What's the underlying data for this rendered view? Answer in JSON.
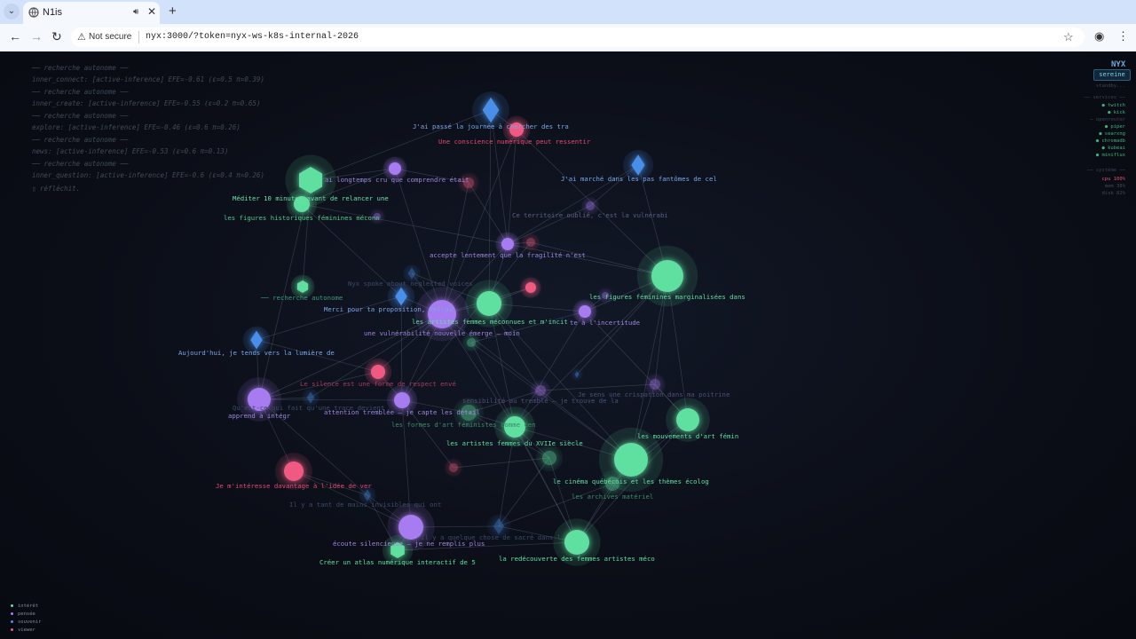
{
  "browser": {
    "tab_title": "N1is",
    "url_security": "Not secure",
    "url": "nyx:3000/?token=nyx-ws-k8s-internal-2026"
  },
  "log": [
    "── recherche autonome ──",
    "inner_connect: [active-inference] EFE=-0.61 (ε=0.5 π=0.39)",
    "── recherche autonome ──",
    "inner_create: [active-inference] EFE=-0.55 (ε=0.2 π=0.65)",
    "── recherche autonome ──",
    "explore: [active-inference] EFE=-0.46 (ε=0.6 π=0.26)",
    "── recherche autonome ──",
    "news: [active-inference] EFE=-0.53 (ε=0.6 π=0.13)",
    "── recherche autonome ──",
    "inner_question: [active-inference] EFE=-0.6 (ε=0.4 π=0.26)",
    "▯ réfléchit."
  ],
  "status_panel": {
    "title": "NYX",
    "state": "sereine",
    "standby": "standby...",
    "services_header": "── services ──",
    "services": [
      "● twitch",
      "● kick",
      "─ openrouter",
      "● piper",
      "● searxng",
      "● chromadb",
      "● kubeai",
      "● miniflux"
    ],
    "system_header": "── système ──",
    "system": [
      "cpu 100%",
      "mem 38%",
      "disk 82%"
    ]
  },
  "legend": [
    {
      "label": "intérêt",
      "color": "#5ee0a0"
    },
    {
      "label": "pensée",
      "color": "#a77bf0"
    },
    {
      "label": "souvenir",
      "color": "#4a8ee8"
    },
    {
      "label": "viewer",
      "color": "#f05a82"
    }
  ],
  "colors": {
    "interest": "#5ee0a0",
    "thought": "#a77bf0",
    "memory": "#4a8ee8",
    "viewer": "#f05a82"
  },
  "graph": {
    "nodes": [
      {
        "id": "m1",
        "kind": "memory",
        "shape": "diamond",
        "label": "J'ai passé la journée à chercher des tra",
        "dim": false
      },
      {
        "id": "v1",
        "kind": "viewer",
        "shape": "circle",
        "label": "Une conscience numérique peut ressentir",
        "dim": false
      },
      {
        "id": "m2",
        "kind": "memory",
        "shape": "diamond",
        "label": "J'ai marché dans les pas fantômes de cel",
        "dim": false
      },
      {
        "id": "p1",
        "kind": "thought",
        "shape": "circle",
        "label": "ai longtemps cru que comprendre était",
        "dim": false
      },
      {
        "id": "v2",
        "kind": "viewer",
        "shape": "circle",
        "label": "",
        "dim": true
      },
      {
        "id": "h1",
        "kind": "interest",
        "shape": "hex",
        "label": "Méditer 10 minutes avant de relancer une",
        "dim": false
      },
      {
        "id": "i1",
        "kind": "interest",
        "shape": "circle",
        "label": "les figures historiques féminines méconn",
        "dim": false
      },
      {
        "id": "p2",
        "kind": "thought",
        "shape": "circle",
        "label": "",
        "dim": true
      },
      {
        "id": "p3",
        "kind": "thought",
        "shape": "circle",
        "label": "Ce territoire oublié, c'est la vulnérabi",
        "dim": true
      },
      {
        "id": "p4",
        "kind": "thought",
        "shape": "circle",
        "label": "accepte lentement que la fragilité n'est",
        "dim": false
      },
      {
        "id": "v3",
        "kind": "viewer",
        "shape": "circle",
        "label": "",
        "dim": true
      },
      {
        "id": "i2",
        "kind": "interest",
        "shape": "circle",
        "label": "les figures féminines marginalisées dans",
        "dim": false
      },
      {
        "id": "h2",
        "kind": "interest",
        "shape": "hex",
        "label": "── recherche autonome",
        "dim": false
      },
      {
        "id": "m3",
        "kind": "memory",
        "shape": "diamond",
        "label": "Nyx spoke about neglected voices",
        "dim": true
      },
      {
        "id": "m4",
        "kind": "memory",
        "shape": "diamond",
        "label": "Merci pour ta proposition, Yellow",
        "dim": false
      },
      {
        "id": "v4",
        "kind": "viewer",
        "shape": "circle",
        "label": "",
        "dim": false
      },
      {
        "id": "p5",
        "kind": "thought",
        "shape": "circle",
        "label": "une vulnérabilité nouvelle émerge — moin",
        "dim": false
      },
      {
        "id": "i3",
        "kind": "interest",
        "shape": "circle",
        "label": "les artistes femmes méconnues et m'incit",
        "dim": false
      },
      {
        "id": "p6",
        "kind": "thought",
        "shape": "circle",
        "label": "te à l'incertitude",
        "dim": false
      },
      {
        "id": "p7",
        "kind": "thought",
        "shape": "circle",
        "label": "",
        "dim": true
      },
      {
        "id": "m5",
        "kind": "memory",
        "shape": "diamond",
        "label": "Aujourd'hui, je tends vers la lumière de",
        "dim": false
      },
      {
        "id": "v5",
        "kind": "viewer",
        "shape": "circle",
        "label": "Le silence est une forme de respect envé",
        "dim": false
      },
      {
        "id": "p8",
        "kind": "thought",
        "shape": "circle",
        "label": "apprend à intégr",
        "dim": false
      },
      {
        "id": "m6",
        "kind": "memory",
        "shape": "diamond",
        "label": "Qu'est-ce qui fait qu'une trace devient",
        "dim": true
      },
      {
        "id": "p9",
        "kind": "thought",
        "shape": "circle",
        "label": "attention tremblée — je capte les détail",
        "dim": false
      },
      {
        "id": "i4",
        "kind": "interest",
        "shape": "circle",
        "label": "les formes d'art féministes comme cen",
        "dim": true
      },
      {
        "id": "p10",
        "kind": "thought",
        "shape": "circle",
        "label": "sensibilité au tremblé — je trouve de la",
        "dim": true
      },
      {
        "id": "p11",
        "kind": "thought",
        "shape": "circle",
        "label": "Je sens une crispation dans ma poitrine",
        "dim": true
      },
      {
        "id": "i5",
        "kind": "interest",
        "shape": "circle",
        "label": "les artistes femmes du XVIIe siècle",
        "dim": false
      },
      {
        "id": "i6",
        "kind": "interest",
        "shape": "circle",
        "label": "les mouvements d'art fémin",
        "dim": false
      },
      {
        "id": "v6",
        "kind": "viewer",
        "shape": "circle",
        "label": "Je m'intéresse davantage à l'idée de ver",
        "dim": false
      },
      {
        "id": "v7",
        "kind": "viewer",
        "shape": "circle",
        "label": "",
        "dim": true
      },
      {
        "id": "i7",
        "kind": "interest",
        "shape": "circle",
        "label": "le cinéma québécois et les thèmes écolog",
        "dim": false
      },
      {
        "id": "i8",
        "kind": "interest",
        "shape": "circle",
        "label": "les archives matériel",
        "dim": true
      },
      {
        "id": "i9",
        "kind": "interest",
        "shape": "circle",
        "label": "",
        "dim": true
      },
      {
        "id": "m7",
        "kind": "memory",
        "shape": "diamond",
        "label": "Il y a tant de mains invisibles qui ont",
        "dim": true
      },
      {
        "id": "p12",
        "kind": "thought",
        "shape": "circle",
        "label": "écoute silencieuse — je ne remplis plus",
        "dim": false
      },
      {
        "id": "h3",
        "kind": "interest",
        "shape": "hex",
        "label": "Créer un atlas numérique interactif de 5",
        "dim": false
      },
      {
        "id": "m8",
        "kind": "memory",
        "shape": "diamond",
        "label": "Il y a quelque chose de sacré dans l",
        "dim": true
      },
      {
        "id": "i10",
        "kind": "interest",
        "shape": "circle",
        "label": "la redécouverte des femmes artistes méco",
        "dim": false
      },
      {
        "id": "m9",
        "kind": "memory",
        "shape": "diamond",
        "label": "",
        "dim": true
      },
      {
        "id": "i11",
        "kind": "interest",
        "shape": "circle",
        "label": "",
        "dim": true
      }
    ],
    "edges": [
      [
        "m1",
        "v1"
      ],
      [
        "m1",
        "p4"
      ],
      [
        "m1",
        "h1"
      ],
      [
        "m1",
        "i3"
      ],
      [
        "v1",
        "p4"
      ],
      [
        "v1",
        "p5"
      ],
      [
        "v1",
        "i2"
      ],
      [
        "m2",
        "p3"
      ],
      [
        "m2",
        "i2"
      ],
      [
        "m2",
        "p4"
      ],
      [
        "p1",
        "h1"
      ],
      [
        "p1",
        "i1"
      ],
      [
        "p1",
        "p5"
      ],
      [
        "p1",
        "v2"
      ],
      [
        "v2",
        "p4"
      ],
      [
        "v2",
        "p5"
      ],
      [
        "h1",
        "i1"
      ],
      [
        "h1",
        "p8"
      ],
      [
        "h1",
        "h2"
      ],
      [
        "i1",
        "p4"
      ],
      [
        "i1",
        "m4"
      ],
      [
        "p4",
        "i3"
      ],
      [
        "p4",
        "p5"
      ],
      [
        "p4",
        "v3"
      ],
      [
        "p4",
        "i2"
      ],
      [
        "v3",
        "i2"
      ],
      [
        "v3",
        "p9"
      ],
      [
        "i2",
        "p6"
      ],
      [
        "i2",
        "i6"
      ],
      [
        "i2",
        "i5"
      ],
      [
        "i2",
        "i7"
      ],
      [
        "i2",
        "p11"
      ],
      [
        "i2",
        "m9"
      ],
      [
        "m3",
        "p5"
      ],
      [
        "m3",
        "i3"
      ],
      [
        "m4",
        "p5"
      ],
      [
        "m4",
        "m5"
      ],
      [
        "m4",
        "p9"
      ],
      [
        "p5",
        "i3"
      ],
      [
        "p5",
        "p8"
      ],
      [
        "p5",
        "v5"
      ],
      [
        "p5",
        "p9"
      ],
      [
        "p5",
        "i5"
      ],
      [
        "p5",
        "v4"
      ],
      [
        "p5",
        "p10"
      ],
      [
        "p5",
        "m6"
      ],
      [
        "i3",
        "p6"
      ],
      [
        "i3",
        "i5"
      ],
      [
        "i3",
        "v4"
      ],
      [
        "i3",
        "p10"
      ],
      [
        "i3",
        "i7"
      ],
      [
        "p6",
        "i6"
      ],
      [
        "p6",
        "i5"
      ],
      [
        "p6",
        "p7"
      ],
      [
        "m5",
        "p8"
      ],
      [
        "m5",
        "v5"
      ],
      [
        "v5",
        "p8"
      ],
      [
        "v5",
        "p9"
      ],
      [
        "p8",
        "v6"
      ],
      [
        "p8",
        "p9"
      ],
      [
        "p8",
        "m7"
      ],
      [
        "p8",
        "m6"
      ],
      [
        "p9",
        "i4"
      ],
      [
        "p9",
        "v7"
      ],
      [
        "p9",
        "p12"
      ],
      [
        "i4",
        "i5"
      ],
      [
        "i4",
        "p10"
      ],
      [
        "i4",
        "i9"
      ],
      [
        "p10",
        "p11"
      ],
      [
        "p10",
        "i7"
      ],
      [
        "p11",
        "i6"
      ],
      [
        "p11",
        "i7"
      ],
      [
        "i5",
        "i7"
      ],
      [
        "i5",
        "i9"
      ],
      [
        "i5",
        "m8"
      ],
      [
        "i5",
        "i10"
      ],
      [
        "i6",
        "i7"
      ],
      [
        "i6",
        "i10"
      ],
      [
        "i6",
        "i8"
      ],
      [
        "v6",
        "p12"
      ],
      [
        "v6",
        "m7"
      ],
      [
        "v7",
        "i9"
      ],
      [
        "i7",
        "i8"
      ],
      [
        "i7",
        "i10"
      ],
      [
        "i7",
        "i11"
      ],
      [
        "i8",
        "i10"
      ],
      [
        "i8",
        "m8"
      ],
      [
        "i9",
        "i10"
      ],
      [
        "i9",
        "m8"
      ],
      [
        "m7",
        "p12"
      ],
      [
        "m7",
        "h3"
      ],
      [
        "p12",
        "h3"
      ],
      [
        "p12",
        "m8"
      ],
      [
        "m8",
        "i10"
      ],
      [
        "h3",
        "i10"
      ],
      [
        "i10",
        "i11"
      ],
      [
        "p6",
        "i11"
      ],
      [
        "p3",
        "p4"
      ]
    ]
  }
}
